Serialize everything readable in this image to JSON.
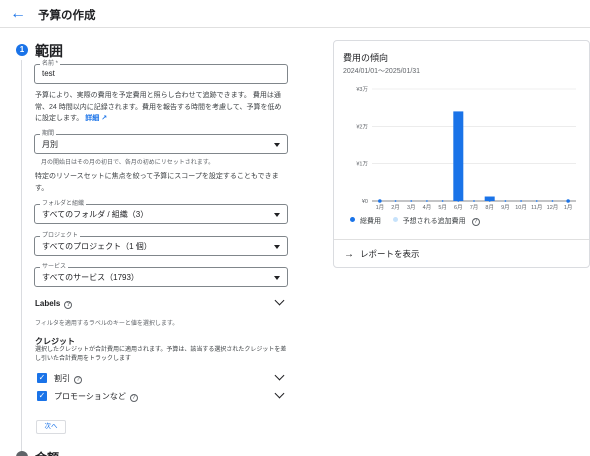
{
  "header": {
    "back_icon": "arrow-left-icon",
    "title": "予算の作成"
  },
  "step1": {
    "number": "1",
    "title": "範囲"
  },
  "step2": {
    "title": "金額"
  },
  "name_field": {
    "label": "名前 *",
    "value": "test"
  },
  "intro": {
    "text": "予算により、実際の費用を予定費用と照らし合わせて追跡できます。 費用は通常、24 時間以内に記録されます。費用を報告する時間を考慮して、予算を低めに設定します。",
    "link": "詳細"
  },
  "period_field": {
    "label": "期間",
    "value": "月別",
    "hint": "月の開始日はその月の初日で、各月の初めにリセットされます。"
  },
  "scope_text": "特定のリソースセットに焦点を絞って予算にスコープを設定することもできます。",
  "folder_field": {
    "label": "フォルダと組織",
    "value": "すべてのフォルダ / 組織（3）"
  },
  "project_field": {
    "label": "プロジェクト",
    "value": "すべてのプロジェクト（1 個）"
  },
  "service_field": {
    "label": "サービス",
    "value": "すべてのサービス（1793）"
  },
  "labels": {
    "title": "Labels",
    "desc": "フィルタを適用するラベルのキーと値を選択します。"
  },
  "credits": {
    "title": "クレジット",
    "desc": "選択したクレジットが合計費用に適用されます。予算は、該当する選択されたクレジットを差し引いた合計費用をトラックします",
    "items": [
      {
        "label": "割引",
        "checked": true
      },
      {
        "label": "プロモーションなど",
        "checked": true
      }
    ]
  },
  "next_button": "次へ",
  "trend": {
    "title": "費用の傾向",
    "range": "2024/01/01～2025/01/31",
    "legend_actual": "総費用",
    "legend_forecast": "予想される追加費用",
    "report_link": "レポートを表示",
    "colors": {
      "actual": "#1a73e8",
      "forecast": "#c6e2fb"
    }
  },
  "chart_data": {
    "type": "bar",
    "categories": [
      "1月",
      "2月",
      "3月",
      "4月",
      "5月",
      "6月",
      "7月",
      "8月",
      "9月",
      "10月",
      "11月",
      "12月",
      "1月"
    ],
    "series": [
      {
        "name": "総費用",
        "values": [
          0,
          0,
          0,
          0,
          0,
          24000,
          0,
          1200,
          0,
          0,
          0,
          0,
          0
        ]
      }
    ],
    "y_ticks": [
      "¥0",
      "¥1万",
      "¥2万",
      "¥3万"
    ],
    "ylim": [
      0,
      30000
    ],
    "grid": true
  }
}
